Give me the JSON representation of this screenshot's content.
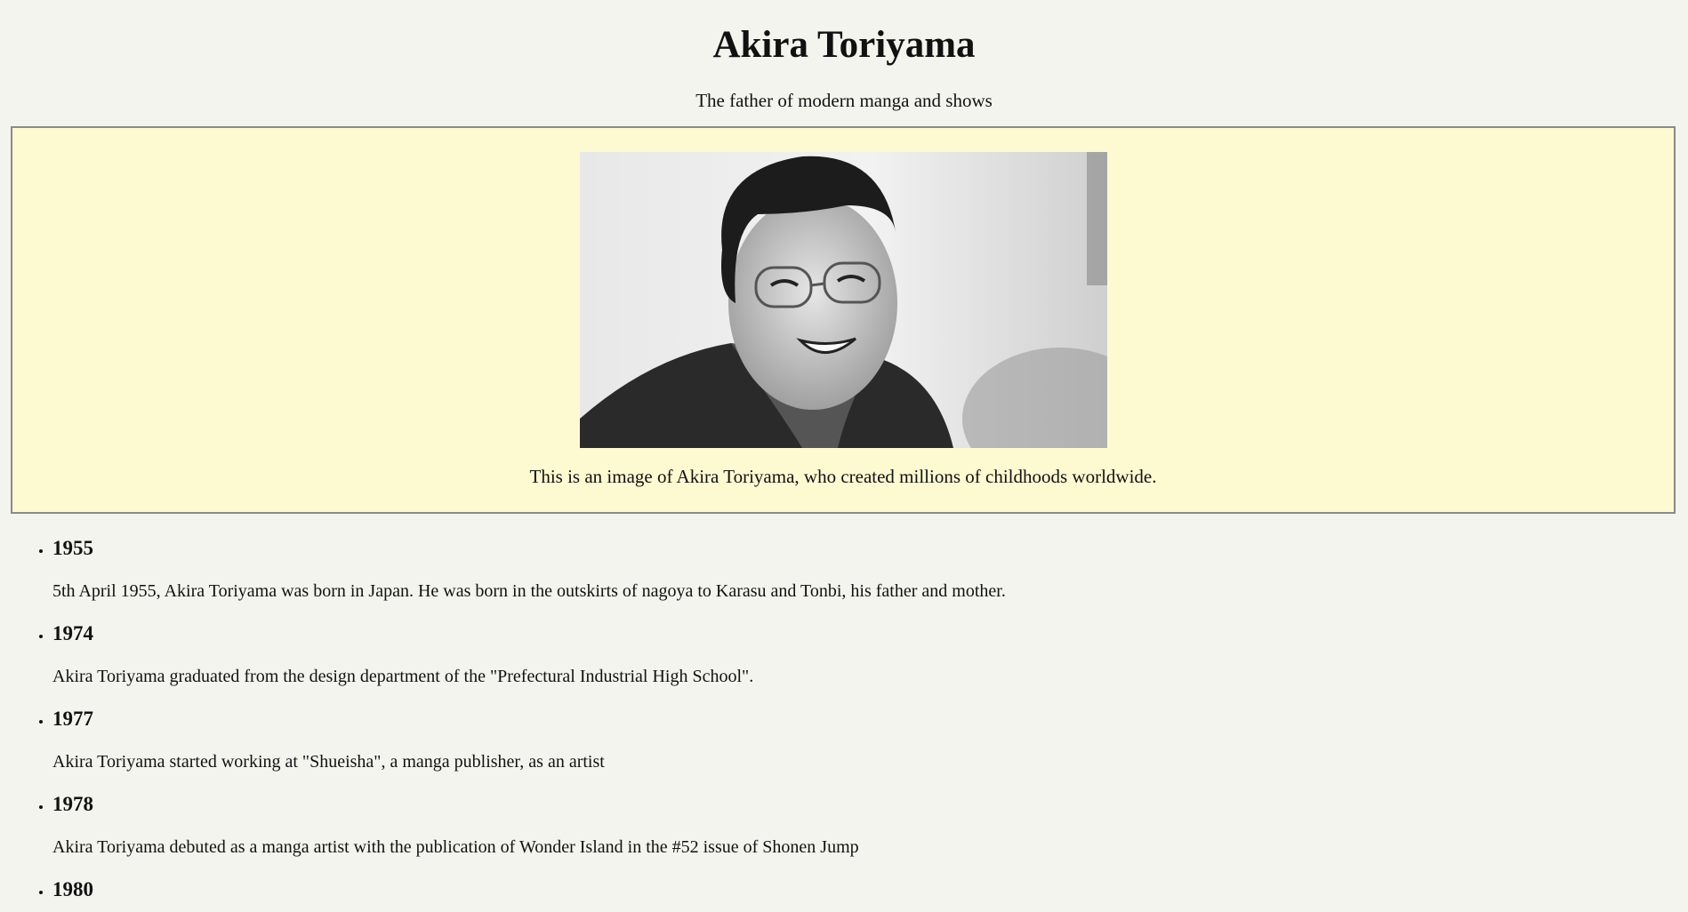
{
  "header": {
    "title": "Akira Toriyama",
    "subtitle": "The father of modern manga and shows"
  },
  "photo_section": {
    "image_alt": "Akira Toriyama",
    "caption": "This is an image of Akira Toriyama, who created millions of childhoods worldwide."
  },
  "timeline": [
    {
      "year": "1955",
      "text": "5th April 1955, Akira Toriyama was born in Japan. He was born in the outskirts of nagoya to Karasu and Tonbi, his father and mother."
    },
    {
      "year": "1974",
      "text": "Akira Toriyama graduated from the design department of the \"Prefectural Industrial High School\"."
    },
    {
      "year": "1977",
      "text": "Akira Toriyama started working at \"Shueisha\", a manga publisher, as an artist"
    },
    {
      "year": "1978",
      "text": "Akira Toriyama debuted as a manga artist with the publication of Wonder Island in the #52 issue of Shonen Jump"
    },
    {
      "year": "1980",
      "text": ""
    }
  ],
  "colors": {
    "page_background": "#f4f4ef",
    "photo_box_background": "#fdfad2",
    "photo_box_border": "#8a8a8a"
  }
}
